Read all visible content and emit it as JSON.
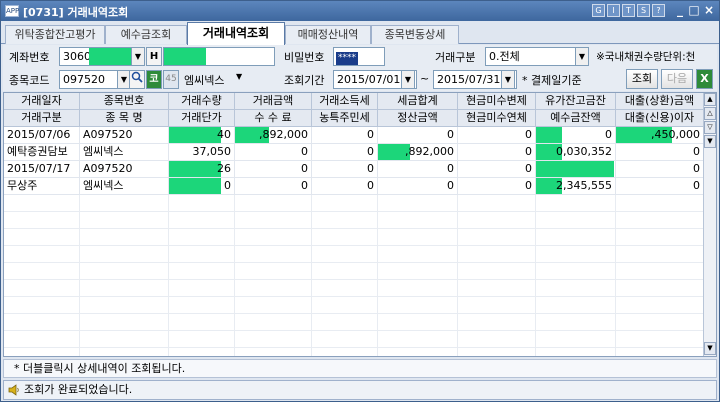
{
  "window": {
    "title": "[0731] 거래내역조회",
    "app_icon": "APP",
    "title_buttons": [
      "G",
      "I",
      "T",
      "S",
      "?"
    ],
    "controls": [
      "_",
      "□",
      "×"
    ]
  },
  "tabs": [
    {
      "label": "위탁종합잔고평가",
      "active": false
    },
    {
      "label": "예수금조회",
      "active": false
    },
    {
      "label": "거래내역조회",
      "active": true
    },
    {
      "label": "매매정산내역",
      "active": false
    },
    {
      "label": "종목변동상세",
      "active": false
    }
  ],
  "form": {
    "account_label": "계좌번호",
    "account_value": "3060",
    "account_h_button": "H",
    "password_label": "비밀번호",
    "password_value": "****",
    "trade_type_label": "거래구분",
    "trade_type_value": "0.전체",
    "bond_note": "※국내채권수량단위:천",
    "stock_code_label": "종목코드",
    "stock_code_value": "097520",
    "stock_badge_1": "코",
    "stock_badge_2": "45",
    "stock_name": "엠씨넥스",
    "period_label": "조회기간",
    "date_from": "2015/07/01",
    "tilde": "~",
    "date_to": "2015/07/31",
    "settle_note": "* 결제일기준",
    "query_button": "조회",
    "next_button": "다음",
    "excel_icon": "X"
  },
  "table": {
    "header_top": [
      "거래일자",
      "종목번호",
      "거래수량",
      "거래금액",
      "거래소득세",
      "세금합계",
      "현금미수변제",
      "유가잔고금잔",
      "대출(상환)금액"
    ],
    "header_bottom": [
      "거래구분",
      "종 목 명",
      "거래단가",
      "수 수 료",
      "농특주민세",
      "정산금액",
      "현금미수연체",
      "예수금잔액",
      "대출(신용)이자"
    ],
    "rows": [
      [
        "2015/07/06",
        "A097520",
        "40",
        ",892,000",
        "0",
        "0",
        "0",
        "0",
        ",450,000"
      ],
      [
        "예탁증권담보",
        "엠씨넥스",
        "37,050",
        "0",
        "0",
        ",892,000",
        "0",
        "0,030,352",
        "0"
      ],
      [
        "2015/07/17",
        "A097520",
        "26",
        "0",
        "0",
        "0",
        "0",
        "",
        "0"
      ],
      [
        "무상주",
        "엠씨넥스",
        "0",
        "0",
        "0",
        "0",
        "0",
        "2,345,555",
        "0"
      ]
    ]
  },
  "note": "* 더블클릭시 상세내역이 조회됩니다.",
  "status": "조회가 완료되었습니다.",
  "colors": {
    "mask_green": "#1cd67a",
    "title_blue": "#3e679e"
  }
}
